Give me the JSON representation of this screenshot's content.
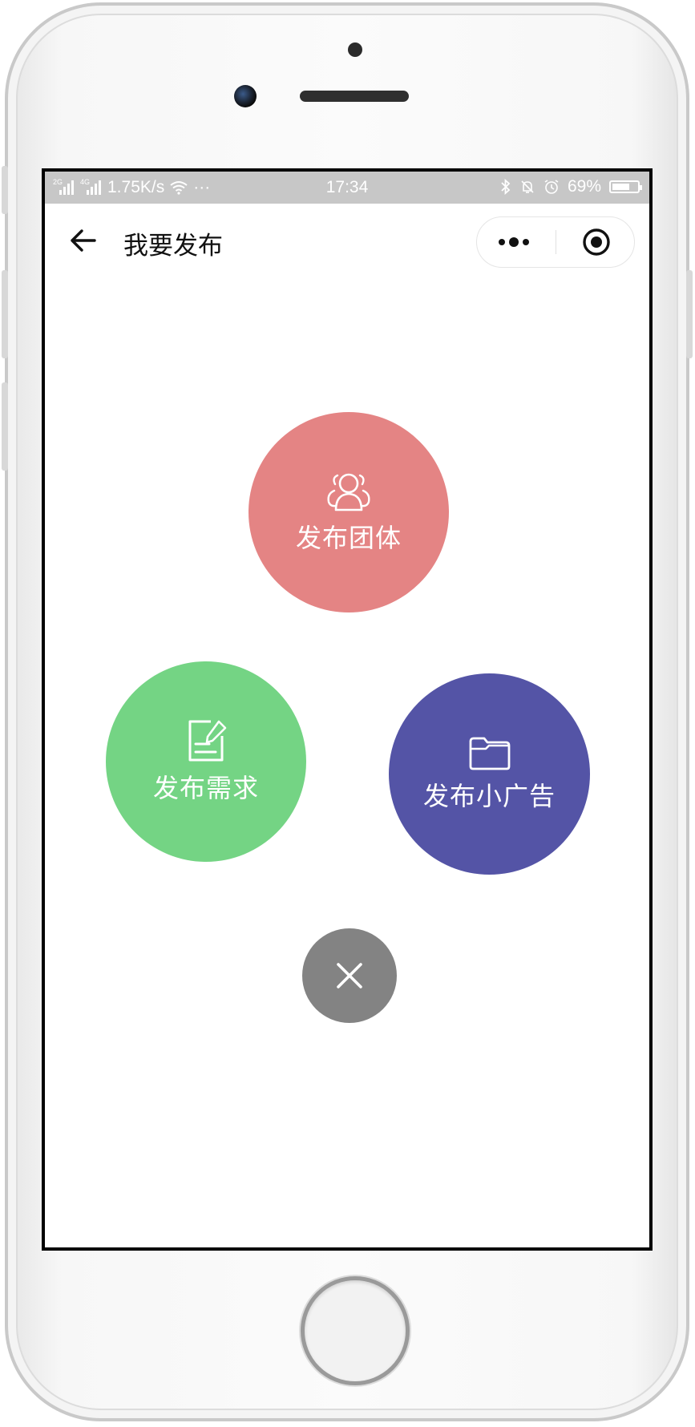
{
  "status_bar": {
    "signal1": "2G",
    "signal2": "4G",
    "speed": "1.75K/s",
    "more": "···",
    "time": "17:34",
    "battery": "69%",
    "battery_level": 0.69
  },
  "navbar": {
    "title": "我要发布"
  },
  "actions": {
    "group": {
      "label": "发布团体",
      "color": "#e48484",
      "icon": "users-icon"
    },
    "demand": {
      "label": "发布需求",
      "color": "#74d484",
      "icon": "edit-note-icon"
    },
    "ad": {
      "label": "发布小广告",
      "color": "#5454a6",
      "icon": "folder-icon"
    },
    "close": {
      "color": "#838383",
      "icon": "close-icon"
    }
  }
}
